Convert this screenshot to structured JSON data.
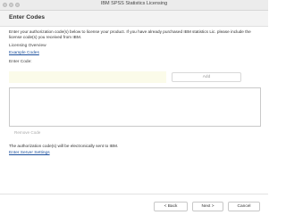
{
  "window": {
    "title": "IBM SPSS Statistics Licensing"
  },
  "header": {
    "title": "Enter Codes"
  },
  "instructions": "Enter your authorization code(s) below to license your product. If you have already purchased IBM statistics Lic. please include the license code(s) you received from IBM.",
  "links": {
    "overview": "Licensing Overview",
    "example_codes": "Example Codes"
  },
  "enter_code": {
    "label": "Enter Code:",
    "value": "",
    "placeholder": ""
  },
  "buttons": {
    "add": "Add",
    "remove": "Remove Code",
    "back": "< Back",
    "next": "Next >",
    "cancel": "Cancel"
  },
  "auth_note": "The authorization code(s) will be electronically sent to IBM.",
  "proxy_link": "Enter Server Settings"
}
